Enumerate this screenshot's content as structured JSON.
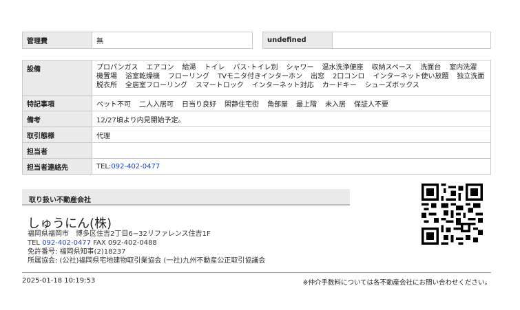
{
  "top_row": {
    "management_fee_label": "管理費",
    "management_fee_value": "無",
    "undefined_label": "undefined",
    "undefined_value": ""
  },
  "details": {
    "equipment_label": "設備",
    "equipment_items": [
      "プロパンガス",
      "エアコン",
      "給湯",
      "トイレ",
      "バス･トイレ別",
      "シャワー",
      "温水洗浄便座",
      "収納スペース",
      "洗面台",
      "室内洗濯",
      "機置場",
      "浴室乾燥機",
      "フローリング",
      "TVモニタ付きインターホン",
      "出窓",
      "2口コンロ",
      "インターネット使い放題",
      "独立洗面",
      "脱衣所",
      "全居室フローリング",
      "スマートロック",
      "インターネット対応",
      "カードキー",
      "シューズボックス"
    ],
    "special_notes_label": "特記事項",
    "special_notes_items": [
      "ペット不可",
      "二人入居可",
      "日当り良好",
      "閑静住宅街",
      "角部屋",
      "最上階",
      "未入居",
      "保証人不要"
    ],
    "remarks_label": "備考",
    "remarks_value": "12/27頃より内見開始予定。",
    "transaction_label": "取引態様",
    "transaction_value": "代理",
    "person_label": "担当者",
    "person_value": "",
    "contact_label": "担当者連絡先",
    "contact_prefix": "TEL:",
    "contact_phone": "092-402-0477"
  },
  "agency": {
    "header": "取り扱い不動産会社",
    "name": "しゅうにん(株)",
    "address": "福岡県福岡市　博多区住吉2丁目6−32リファレンス住吉1F",
    "tel_label": "TEL",
    "tel": "092-402-0477",
    "fax_text": "FAX 092-402-0488",
    "license": "免許番号: 福岡県知事(2)18237",
    "association": "所属協会: (公社)福岡県宅地建物取引業協会 (一社)九州不動産公正取引協議会"
  },
  "footer": {
    "timestamp": "2025-01-18 10:19:53",
    "note": "※仲介手数料については各不動産会社にお問い合わせください。"
  },
  "colors": {
    "link": "#1a3fc4",
    "label_bg": "#eaeaea",
    "border": "#c9c9c9"
  }
}
